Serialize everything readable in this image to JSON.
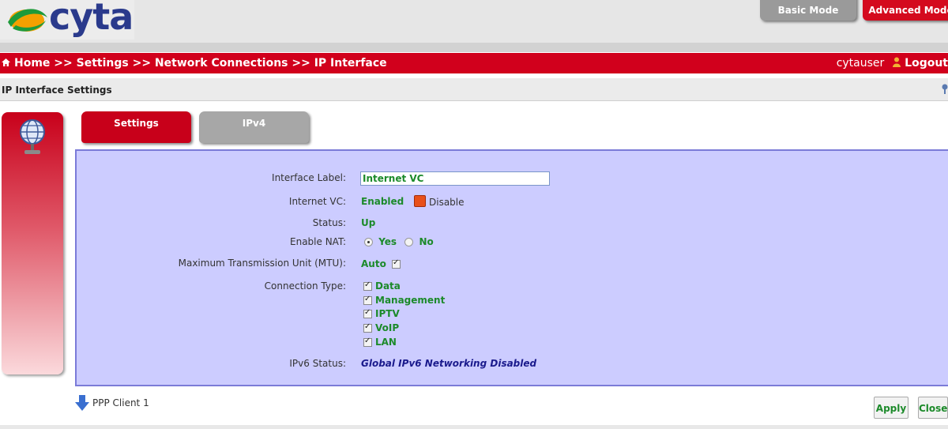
{
  "header": {
    "logo_text": "cyta",
    "modes": {
      "basic": "Basic Mode",
      "advanced": "Advanced Mode"
    }
  },
  "breadcrumb": "Home >> Settings >> Network Connections >> IP Interface",
  "user": {
    "name": "cytauser",
    "logout_label": "Logout"
  },
  "page_title": "IP Interface Settings",
  "tabs": [
    {
      "label": "Settings",
      "active": true
    },
    {
      "label": "IPv4",
      "active": false
    }
  ],
  "form": {
    "interface_label": {
      "label": "Interface Label:",
      "value": "Internet VC"
    },
    "internet_vc": {
      "label": "Internet VC:",
      "value": "Enabled",
      "action": "Disable"
    },
    "status": {
      "label": "Status:",
      "value": "Up"
    },
    "enable_nat": {
      "label": "Enable NAT:",
      "options": [
        "Yes",
        "No"
      ],
      "selected": "Yes"
    },
    "mtu": {
      "label": "Maximum Transmission Unit (MTU):",
      "value": "Auto",
      "checked": true
    },
    "connection_type": {
      "label": "Connection Type:",
      "items": [
        "Data",
        "Management",
        "IPTV",
        "VoIP",
        "LAN"
      ]
    },
    "ipv6_status": {
      "label": "IPv6 Status:",
      "value": "Global IPv6 Networking Disabled"
    }
  },
  "footer": {
    "ppp_link": "PPP Client 1",
    "apply_label": "Apply",
    "close_label": "Close"
  },
  "colors": {
    "brand_red": "#d1001c",
    "panel_bg": "#ccccff",
    "value_green": "#1c8a2a",
    "logo_blue": "#2a3a8c"
  }
}
